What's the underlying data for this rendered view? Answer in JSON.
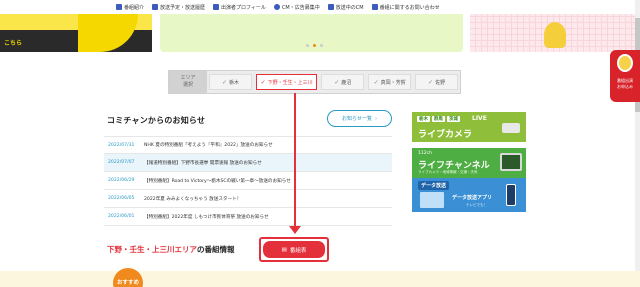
{
  "topnav": {
    "items": [
      {
        "icon": "home-icon",
        "label": "番組紹介"
      },
      {
        "icon": "calendar-icon",
        "label": "放送予定・放送履歴"
      },
      {
        "icon": "monitor-icon",
        "label": "出演者プロフィール"
      },
      {
        "icon": "cm-icon",
        "label": "CM・広告募集中"
      },
      {
        "icon": "megaphone-icon",
        "label": "放送中のCM"
      },
      {
        "icon": "mail-icon",
        "label": "番組に関するお問い合わせ"
      }
    ]
  },
  "slider": {
    "left_cta": "こちら",
    "active_dot": 1
  },
  "side_tab": {
    "line1": "番組出演",
    "line2": "お申込み"
  },
  "area_select": {
    "label_line1": "エリア",
    "label_line2": "選択",
    "tabs": [
      {
        "label": "栃木",
        "active": false
      },
      {
        "label": "下野・壬生・上三川",
        "active": true
      },
      {
        "label": "鹿沼",
        "active": false
      },
      {
        "label": "真岡・芳賀",
        "active": false
      },
      {
        "label": "佐野",
        "active": false
      }
    ]
  },
  "news": {
    "title": "コミチャンからのお知らせ",
    "more_label": "お知らせ一覧",
    "items": [
      {
        "date": "2022/07/31",
        "text": "NHK 夏の特別番組「考えよう『平和』2022」放送のお知らせ"
      },
      {
        "date": "2022/07/07",
        "text": "【報道特別番組】下野市長選挙 開票速報 放送のお知らせ"
      },
      {
        "date": "2022/06/29",
        "text": "【特別番組】Road to Victory～栃木SCの戦い第一章～放送のお知らせ"
      },
      {
        "date": "2022/06/05",
        "text": "2022年夏 みみよくなっちゃう 放送スタート！"
      },
      {
        "date": "2022/06/01",
        "text": "【特別番組】2022年度 しもつけ市民体育祭 放送のお知らせ"
      }
    ]
  },
  "banners": {
    "b1_tags": [
      "栃木",
      "群馬",
      "茨城"
    ],
    "b1_live": "LIVE",
    "b1_title": "ライブカメラ",
    "b2_channel": "112ch",
    "b2_title": "ライフチャンネル",
    "b2_sub": "ライブカメラ・地域情報・交通・天気",
    "b3_title": "データ放送",
    "b3_sub": "データ放送アプリ",
    "b3_sub2": "テレビでも！"
  },
  "bottom": {
    "area_red": "下野・壬生・上三川エリア",
    "area_black": "の番組情報",
    "bangumi_label": "番組表",
    "osusume": "おすすめ"
  },
  "colors": {
    "accent_red": "#e3303b",
    "link_blue": "#2a9ac4",
    "orange": "#f08a1c"
  }
}
